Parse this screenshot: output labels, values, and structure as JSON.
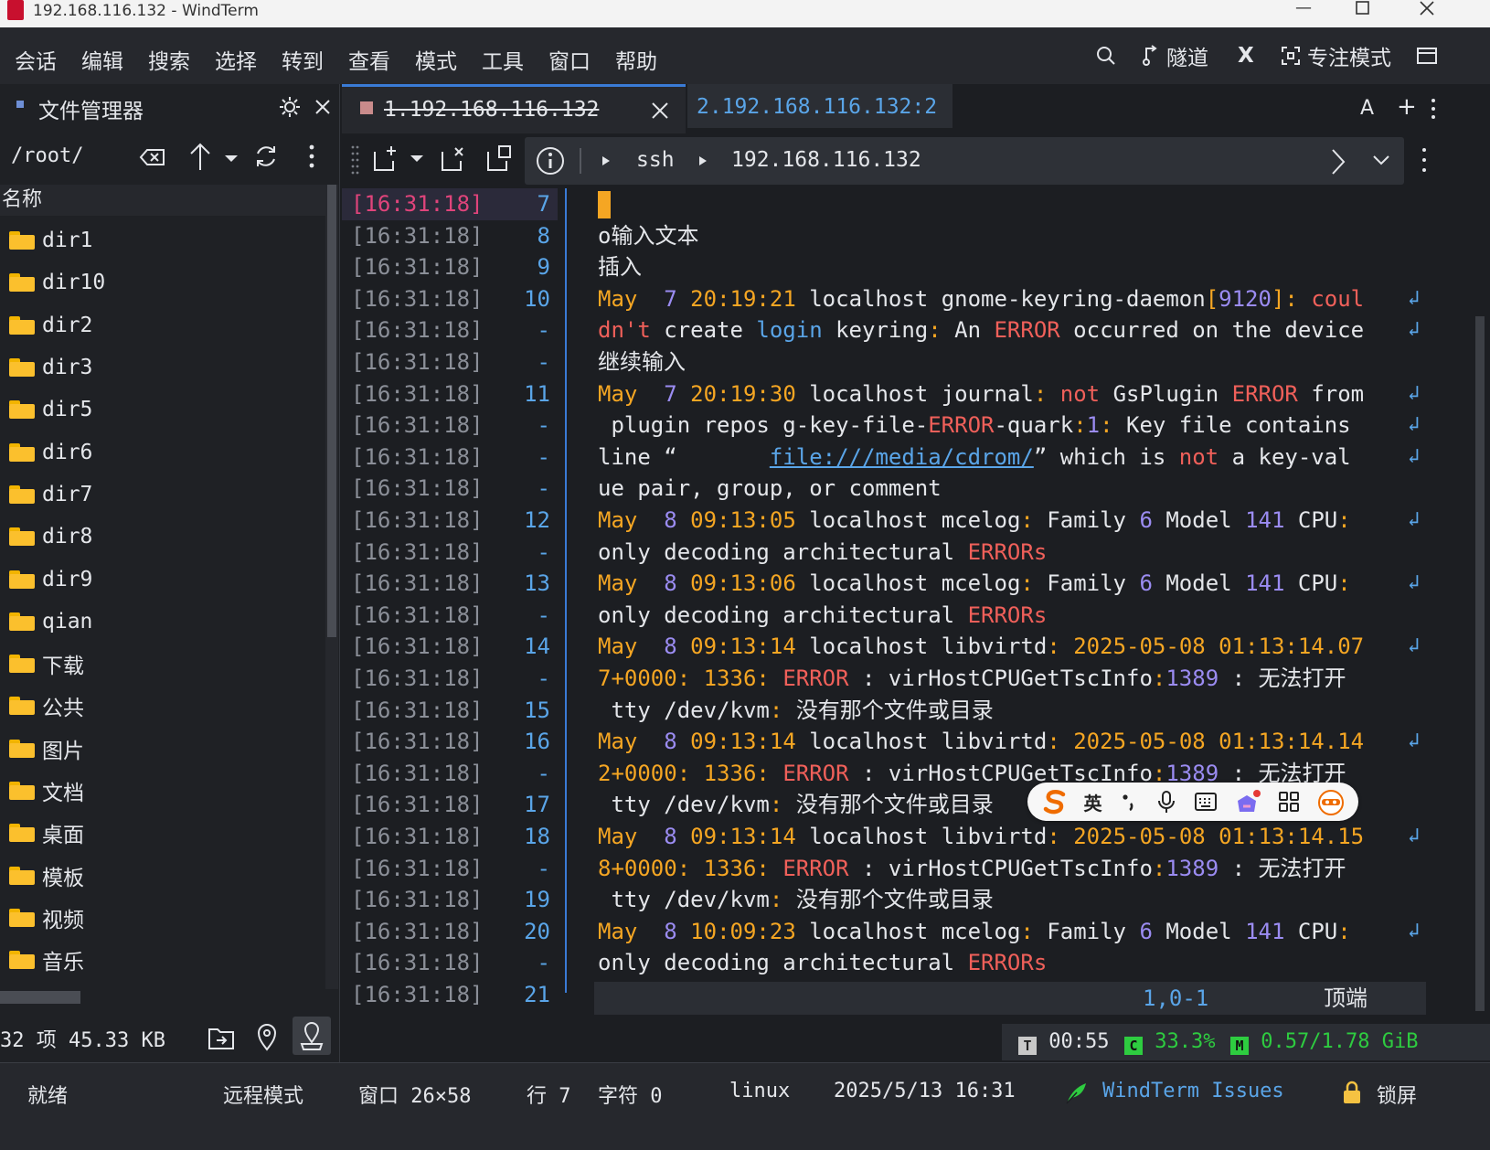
{
  "window": {
    "title": "192.168.116.132 - WindTerm"
  },
  "menu": {
    "items": [
      "会话",
      "编辑",
      "搜索",
      "选择",
      "转到",
      "查看",
      "模式",
      "工具",
      "窗口",
      "帮助"
    ],
    "tunnel": "隧道",
    "x_label": "X",
    "focus": "专注模式"
  },
  "file_manager": {
    "title": "文件管理器",
    "path": "/root/",
    "column_name": "名称",
    "items": [
      "dir1",
      "dir10",
      "dir2",
      "dir3",
      "dir5",
      "dir6",
      "dir7",
      "dir8",
      "dir9",
      "qian",
      "下载",
      "公共",
      "图片",
      "文档",
      "桌面",
      "模板",
      "视频",
      "音乐"
    ],
    "status": "32 项 45.33 KB"
  },
  "tabs": [
    {
      "label": "1.192.168.116.132",
      "active": true
    },
    {
      "label": "2.192.168.116.132:2",
      "active": false
    }
  ],
  "tab_actions": {
    "font": "A",
    "add": "+"
  },
  "address": {
    "protocol": "ssh",
    "host": "192.168.116.132"
  },
  "terminal": {
    "lines": [
      {
        "ts": "[16:31:18]",
        "ln": "7",
        "parts": []
      },
      {
        "ts": "[16:31:18]",
        "ln": "8",
        "parts": [
          [
            "o输入文本",
            "w"
          ]
        ]
      },
      {
        "ts": "[16:31:18]",
        "ln": "9",
        "parts": [
          [
            "插入",
            "w"
          ]
        ]
      },
      {
        "ts": "[16:31:18]",
        "ln": "10",
        "wrap": true,
        "parts": [
          [
            "May",
            "o"
          ],
          [
            "  ",
            "w"
          ],
          [
            "7",
            "p"
          ],
          [
            " ",
            "w"
          ],
          [
            "20:19:21",
            "o"
          ],
          [
            " localhost gnome-keyring-daemon",
            "w"
          ],
          [
            "[",
            "o"
          ],
          [
            "9120",
            "p"
          ],
          [
            "]",
            "o"
          ],
          [
            ": ",
            "o"
          ],
          [
            "coul",
            "r"
          ]
        ]
      },
      {
        "ts": "[16:31:18]",
        "ln": "-",
        "wrap": true,
        "parts": [
          [
            "dn't",
            "r"
          ],
          [
            " create ",
            "w"
          ],
          [
            "login",
            "b"
          ],
          [
            " keyring",
            "w"
          ],
          [
            ":",
            "o"
          ],
          [
            " An ",
            "w"
          ],
          [
            "ERROR",
            "r"
          ],
          [
            " occurred on the device",
            "w"
          ]
        ]
      },
      {
        "ts": "[16:31:18]",
        "ln": "-",
        "parts": [
          [
            "继续输入",
            "w"
          ]
        ]
      },
      {
        "ts": "[16:31:18]",
        "ln": "11",
        "wrap": true,
        "parts": [
          [
            "May",
            "o"
          ],
          [
            "  ",
            "w"
          ],
          [
            "7",
            "p"
          ],
          [
            " ",
            "w"
          ],
          [
            "20:19:30",
            "o"
          ],
          [
            " localhost journal",
            "w"
          ],
          [
            ": ",
            "o"
          ],
          [
            "not",
            "r"
          ],
          [
            " GsPlugin ",
            "w"
          ],
          [
            "ERROR",
            "r"
          ],
          [
            " from",
            "w"
          ]
        ]
      },
      {
        "ts": "[16:31:18]",
        "ln": "-",
        "wrap": true,
        "parts": [
          [
            " plugin repos g-key-file-",
            "w"
          ],
          [
            "ERROR",
            "r"
          ],
          [
            "-quark",
            "w"
          ],
          [
            ":",
            "o"
          ],
          [
            "1",
            "p"
          ],
          [
            ":",
            "o"
          ],
          [
            " Key file contains",
            "w"
          ]
        ]
      },
      {
        "ts": "[16:31:18]",
        "ln": "-",
        "wrap": true,
        "parts": [
          [
            "line “       ",
            "w"
          ],
          [
            "file:///media/cdrom/",
            "bu"
          ],
          [
            "” which is ",
            "w"
          ],
          [
            "not",
            "r"
          ],
          [
            " a key-val",
            "w"
          ]
        ]
      },
      {
        "ts": "[16:31:18]",
        "ln": "-",
        "parts": [
          [
            "ue pair, group, or comment",
            "w"
          ]
        ]
      },
      {
        "ts": "[16:31:18]",
        "ln": "12",
        "wrap": true,
        "parts": [
          [
            "May",
            "o"
          ],
          [
            "  ",
            "w"
          ],
          [
            "8",
            "p"
          ],
          [
            " ",
            "w"
          ],
          [
            "09:13:05",
            "o"
          ],
          [
            " localhost mcelog",
            "w"
          ],
          [
            ":",
            "o"
          ],
          [
            " Family ",
            "w"
          ],
          [
            "6",
            "p"
          ],
          [
            " Model ",
            "w"
          ],
          [
            "141",
            "p"
          ],
          [
            " CPU",
            "w"
          ],
          [
            ":",
            "o"
          ]
        ]
      },
      {
        "ts": "[16:31:18]",
        "ln": "-",
        "parts": [
          [
            "only decoding architectural ",
            "w"
          ],
          [
            "ERRORs",
            "r"
          ]
        ]
      },
      {
        "ts": "[16:31:18]",
        "ln": "13",
        "wrap": true,
        "parts": [
          [
            "May",
            "o"
          ],
          [
            "  ",
            "w"
          ],
          [
            "8",
            "p"
          ],
          [
            " ",
            "w"
          ],
          [
            "09:13:06",
            "o"
          ],
          [
            " localhost mcelog",
            "w"
          ],
          [
            ":",
            "o"
          ],
          [
            " Family ",
            "w"
          ],
          [
            "6",
            "p"
          ],
          [
            " Model ",
            "w"
          ],
          [
            "141",
            "p"
          ],
          [
            " CPU",
            "w"
          ],
          [
            ":",
            "o"
          ]
        ]
      },
      {
        "ts": "[16:31:18]",
        "ln": "-",
        "parts": [
          [
            "only decoding architectural ",
            "w"
          ],
          [
            "ERRORs",
            "r"
          ]
        ]
      },
      {
        "ts": "[16:31:18]",
        "ln": "14",
        "wrap": true,
        "parts": [
          [
            "May",
            "o"
          ],
          [
            "  ",
            "w"
          ],
          [
            "8",
            "p"
          ],
          [
            " ",
            "w"
          ],
          [
            "09:13:14",
            "o"
          ],
          [
            " localhost libvirtd",
            "w"
          ],
          [
            ": ",
            "o"
          ],
          [
            "2025-05-08 01:13:14.07",
            "o"
          ]
        ]
      },
      {
        "ts": "[16:31:18]",
        "ln": "-",
        "parts": [
          [
            "7+0000",
            "o"
          ],
          [
            ": ",
            "o"
          ],
          [
            "1336",
            "o"
          ],
          [
            ": ",
            "o"
          ],
          [
            "ERROR",
            "r"
          ],
          [
            " : virHostCPUGetTscInfo",
            "w"
          ],
          [
            ":",
            "o"
          ],
          [
            "1389",
            "p"
          ],
          [
            " : 无法打开",
            "w"
          ]
        ]
      },
      {
        "ts": "[16:31:18]",
        "ln": "15",
        "parts": [
          [
            " tty /dev/kvm",
            "w"
          ],
          [
            ": ",
            "o"
          ],
          [
            "没有那个文件或目录",
            "w"
          ]
        ]
      },
      {
        "ts": "[16:31:18]",
        "ln": "16",
        "wrap": true,
        "parts": [
          [
            "May",
            "o"
          ],
          [
            "  ",
            "w"
          ],
          [
            "8",
            "p"
          ],
          [
            " ",
            "w"
          ],
          [
            "09:13:14",
            "o"
          ],
          [
            " localhost libvirtd",
            "w"
          ],
          [
            ": ",
            "o"
          ],
          [
            "2025-05-08 01:13:14.14",
            "o"
          ]
        ]
      },
      {
        "ts": "[16:31:18]",
        "ln": "-",
        "parts": [
          [
            "2+0000",
            "o"
          ],
          [
            ": ",
            "o"
          ],
          [
            "1336",
            "o"
          ],
          [
            ": ",
            "o"
          ],
          [
            "ERROR",
            "r"
          ],
          [
            " : virHostCPUGetTscInfo",
            "w"
          ],
          [
            ":",
            "o"
          ],
          [
            "1389",
            "p"
          ],
          [
            " : 无法打开",
            "w"
          ]
        ]
      },
      {
        "ts": "[16:31:18]",
        "ln": "17",
        "parts": [
          [
            " tty /dev/kvm",
            "w"
          ],
          [
            ": ",
            "o"
          ],
          [
            "没有那个文件或目录",
            "w"
          ]
        ]
      },
      {
        "ts": "[16:31:18]",
        "ln": "18",
        "wrap": true,
        "parts": [
          [
            "May",
            "o"
          ],
          [
            "  ",
            "w"
          ],
          [
            "8",
            "p"
          ],
          [
            " ",
            "w"
          ],
          [
            "09:13:14",
            "o"
          ],
          [
            " localhost libvirtd",
            "w"
          ],
          [
            ": ",
            "o"
          ],
          [
            "2025-05-08 01:13:14.15",
            "o"
          ]
        ]
      },
      {
        "ts": "[16:31:18]",
        "ln": "-",
        "parts": [
          [
            "8+0000",
            "o"
          ],
          [
            ": ",
            "o"
          ],
          [
            "1336",
            "o"
          ],
          [
            ": ",
            "o"
          ],
          [
            "ERROR",
            "r"
          ],
          [
            " : virHostCPUGetTscInfo",
            "w"
          ],
          [
            ":",
            "o"
          ],
          [
            "1389",
            "p"
          ],
          [
            " : 无法打开",
            "w"
          ]
        ]
      },
      {
        "ts": "[16:31:18]",
        "ln": "19",
        "parts": [
          [
            " tty /dev/kvm",
            "w"
          ],
          [
            ": ",
            "o"
          ],
          [
            "没有那个文件或目录",
            "w"
          ]
        ]
      },
      {
        "ts": "[16:31:18]",
        "ln": "20",
        "wrap": true,
        "parts": [
          [
            "May",
            "o"
          ],
          [
            "  ",
            "w"
          ],
          [
            "8",
            "p"
          ],
          [
            " ",
            "w"
          ],
          [
            "10:09:23",
            "o"
          ],
          [
            " localhost mcelog",
            "w"
          ],
          [
            ":",
            "o"
          ],
          [
            " Family ",
            "w"
          ],
          [
            "6",
            "p"
          ],
          [
            " Model ",
            "w"
          ],
          [
            "141",
            "p"
          ],
          [
            " CPU",
            "w"
          ],
          [
            ":",
            "o"
          ]
        ]
      },
      {
        "ts": "[16:31:18]",
        "ln": "-",
        "parts": [
          [
            "only decoding architectural ",
            "w"
          ],
          [
            "ERRORs",
            "r"
          ]
        ]
      },
      {
        "ts": "[16:31:18]",
        "ln": "21",
        "parts": []
      }
    ],
    "vim_status": {
      "position": "1,0-1",
      "scroll": "顶端"
    }
  },
  "ime": {
    "mode": "英"
  },
  "monitor": {
    "time_badge": "T",
    "time": "00:55",
    "cpu_badge": "C",
    "cpu": "33.3%",
    "mem_badge": "M",
    "mem": "0.57/1.78 GiB"
  },
  "statusbar": {
    "ready": "就绪",
    "mode": "远程模式",
    "window": "窗口 26×58",
    "line": "行 7",
    "char": "字符 0",
    "os": "linux",
    "datetime": "2025/5/13 16:31",
    "issues": "WindTerm Issues",
    "lock": "锁屏"
  },
  "colors": {
    "accent": "#3a7bd5",
    "link": "#5aa5e8",
    "error": "#f0605a",
    "time": "#f5a623",
    "number": "#9b8cf2",
    "highlight_ts": "#e0447b",
    "folder": "#fbc02d",
    "badge_green": "#2ecc40"
  },
  "icons": [
    "search-icon",
    "tunnel-icon",
    "focus-icon",
    "gear-icon",
    "close-icon",
    "backspace-icon",
    "up-arrow-icon",
    "chevron-down-icon",
    "refresh-icon",
    "more-icon",
    "new-tab-icon",
    "detach-icon",
    "split-icon",
    "info-icon",
    "chevron-right-icon",
    "folder-icon",
    "upload-icon",
    "location-icon",
    "map-pin-icon",
    "lock-icon",
    "feather-icon"
  ]
}
